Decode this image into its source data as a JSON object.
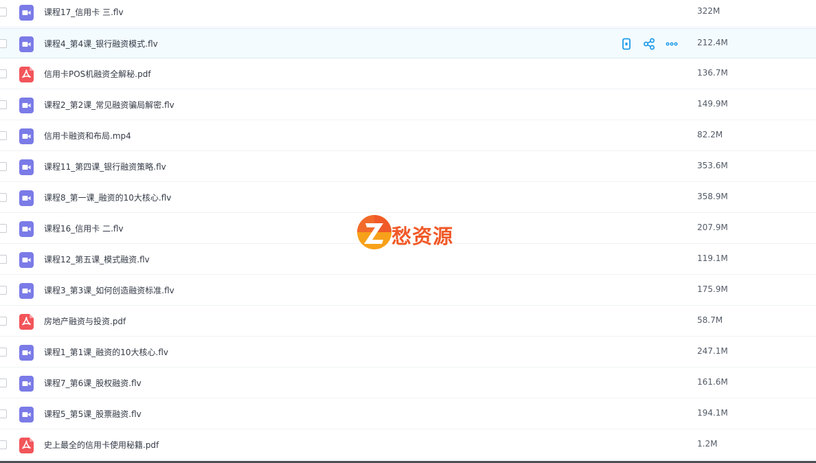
{
  "colors": {
    "video_icon": "#7b7be8",
    "pdf_icon": "#f2555a",
    "action_icon": "#1b9be8",
    "hover_row": "#f4fbff",
    "watermark": "#f05a28"
  },
  "row_actions": {
    "icons": [
      "phone-icon",
      "share-icon",
      "more-icon"
    ]
  },
  "watermark": {
    "text": "愁资源"
  },
  "files": [
    {
      "name": "课程17_信用卡 三.flv",
      "size": "322M",
      "type": "video"
    },
    {
      "name": "课程4_第4课_银行融资模式.flv",
      "size": "212.4M",
      "type": "video",
      "hovered": true
    },
    {
      "name": "信用卡POS机融资全解秘.pdf",
      "size": "136.7M",
      "type": "pdf"
    },
    {
      "name": "课程2_第2课_常见融资骗局解密.flv",
      "size": "149.9M",
      "type": "video"
    },
    {
      "name": "信用卡融资和布局.mp4",
      "size": "82.2M",
      "type": "video"
    },
    {
      "name": "课程11_第四课_银行融资策略.flv",
      "size": "353.6M",
      "type": "video"
    },
    {
      "name": "课程8_第一课_融资的10大核心.flv",
      "size": "358.9M",
      "type": "video"
    },
    {
      "name": "课程16_信用卡 二.flv",
      "size": "207.9M",
      "type": "video"
    },
    {
      "name": "课程12_第五课_模式融资.flv",
      "size": "119.1M",
      "type": "video"
    },
    {
      "name": "课程3_第3课_如何创造融资标准.flv",
      "size": "175.9M",
      "type": "video"
    },
    {
      "name": "房地产融资与投资.pdf",
      "size": "58.7M",
      "type": "pdf"
    },
    {
      "name": "课程1_第1课_融资的10大核心.flv",
      "size": "247.1M",
      "type": "video"
    },
    {
      "name": "课程7_第6课_股权融资.flv",
      "size": "161.6M",
      "type": "video"
    },
    {
      "name": "课程5_第5课_股票融资.flv",
      "size": "194.1M",
      "type": "video"
    },
    {
      "name": "史上最全的信用卡使用秘籍.pdf",
      "size": "1.2M",
      "type": "pdf"
    }
  ]
}
